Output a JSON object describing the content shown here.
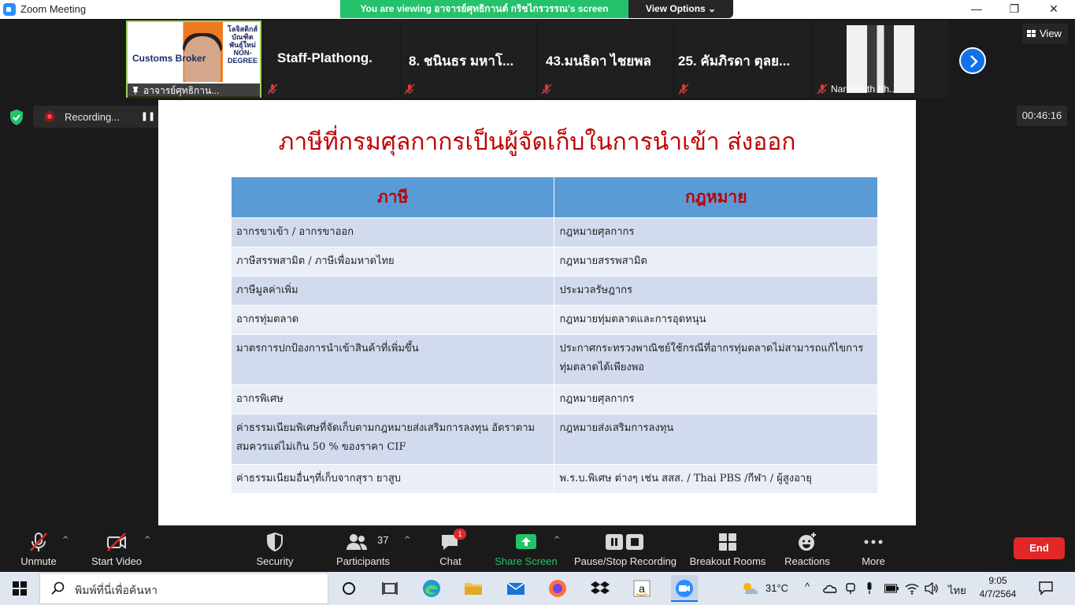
{
  "window": {
    "title": "Zoom Meeting",
    "minimize": "—",
    "maximize": "❐",
    "close": "✕"
  },
  "banner": {
    "text": "You are viewing อาจารย์ศุทธิกานต์  กริชไกรวรรณ's screen",
    "view_options": "View Options ⌄"
  },
  "participants_strip": [
    {
      "name": "อาจารย์ศุทธิกาน...",
      "type": "video",
      "brand_left": "Customs Broker",
      "brand_right": "โลจิสติกส์ บัณฑิตพันธุ์ใหม่ NON-DEGREE"
    },
    {
      "name": "Staff-Plathong.",
      "type": "name"
    },
    {
      "name": "8. ชนินธร มหาโ...",
      "type": "name"
    },
    {
      "name": "43.มนธิดา ไชยพล",
      "type": "name"
    },
    {
      "name": "25. คัมภิรดา ตุลย...",
      "type": "name"
    },
    {
      "name": "Nareenath Ph...",
      "type": "photo"
    }
  ],
  "view_button": "View",
  "recording": {
    "label": "Recording...",
    "pause": "❚❚",
    "stop": "■"
  },
  "timer": "00:46:16",
  "slide": {
    "title": "ภาษีที่กรมศุลกากรเป็นผู้จัดเก็บในการนำเข้า ส่งออก",
    "headers": [
      "ภาษี",
      "กฎหมาย"
    ],
    "rows": [
      [
        "อากรขาเข้า  / อากรขาออก",
        "กฎหมายศุลกากร"
      ],
      [
        "ภาษีสรรพสามิต / ภาษีเพื่อมหาดไทย",
        "กฎหมายสรรพสามิต"
      ],
      [
        "ภาษีมูลค่าเพิ่ม",
        "ประมวลรัษฎากร"
      ],
      [
        "อากรทุ่มตลาด",
        "กฎหมายทุ่มตลาดและการอุดหนุน"
      ],
      [
        "มาตรการปกป้องการนำเข้าสินค้าที่เพิ่มขึ้น",
        "ประกาศกระทรวงพาณิชย์ใช้กรณีที่อากรทุ่มตลาดไม่สามารถแก้ไขการทุ่มตลาดได้เพียงพอ"
      ],
      [
        "อากรพิเศษ",
        "กฎหมายศุลกากร"
      ],
      [
        "ค่าธรรมเนียมพิเศษที่จัดเก็บตามกฎหมายส่งเสริมการลงทุน อัตราตามสมควรแต่ไม่เกิน 50 % ของราคา CIF",
        "กฎหมายส่งเสริมการลงทุน"
      ],
      [
        "ค่าธรรมเนียมอื่นๆที่เก็บจากสุรา ยาสูบ",
        "พ.ร.บ.พิเศษ ต่างๆ เช่น สสส. /  Thai PBS /กีฬา / ผู้สูงอายุ"
      ]
    ]
  },
  "toolbar": {
    "unmute": "Unmute",
    "start_video": "Start Video",
    "security": "Security",
    "participants": "Participants",
    "participants_count": "37",
    "chat": "Chat",
    "chat_badge": "1",
    "share_screen": "Share Screen",
    "pause_stop_recording": "Pause/Stop Recording",
    "breakout_rooms": "Breakout Rooms",
    "reactions": "Reactions",
    "more": "More",
    "end": "End"
  },
  "taskbar": {
    "search_placeholder": "พิมพ์ที่นี่เพื่อค้นหา",
    "temperature": "31°C",
    "language": "ไทย",
    "time": "9:05",
    "date": "4/7/2564"
  },
  "colors": {
    "zoom_blue": "#0e72ed",
    "share_green": "#23c26b",
    "end_red": "#e02828",
    "slide_title_red": "#c00000",
    "table_header_blue": "#5b9bd5"
  }
}
